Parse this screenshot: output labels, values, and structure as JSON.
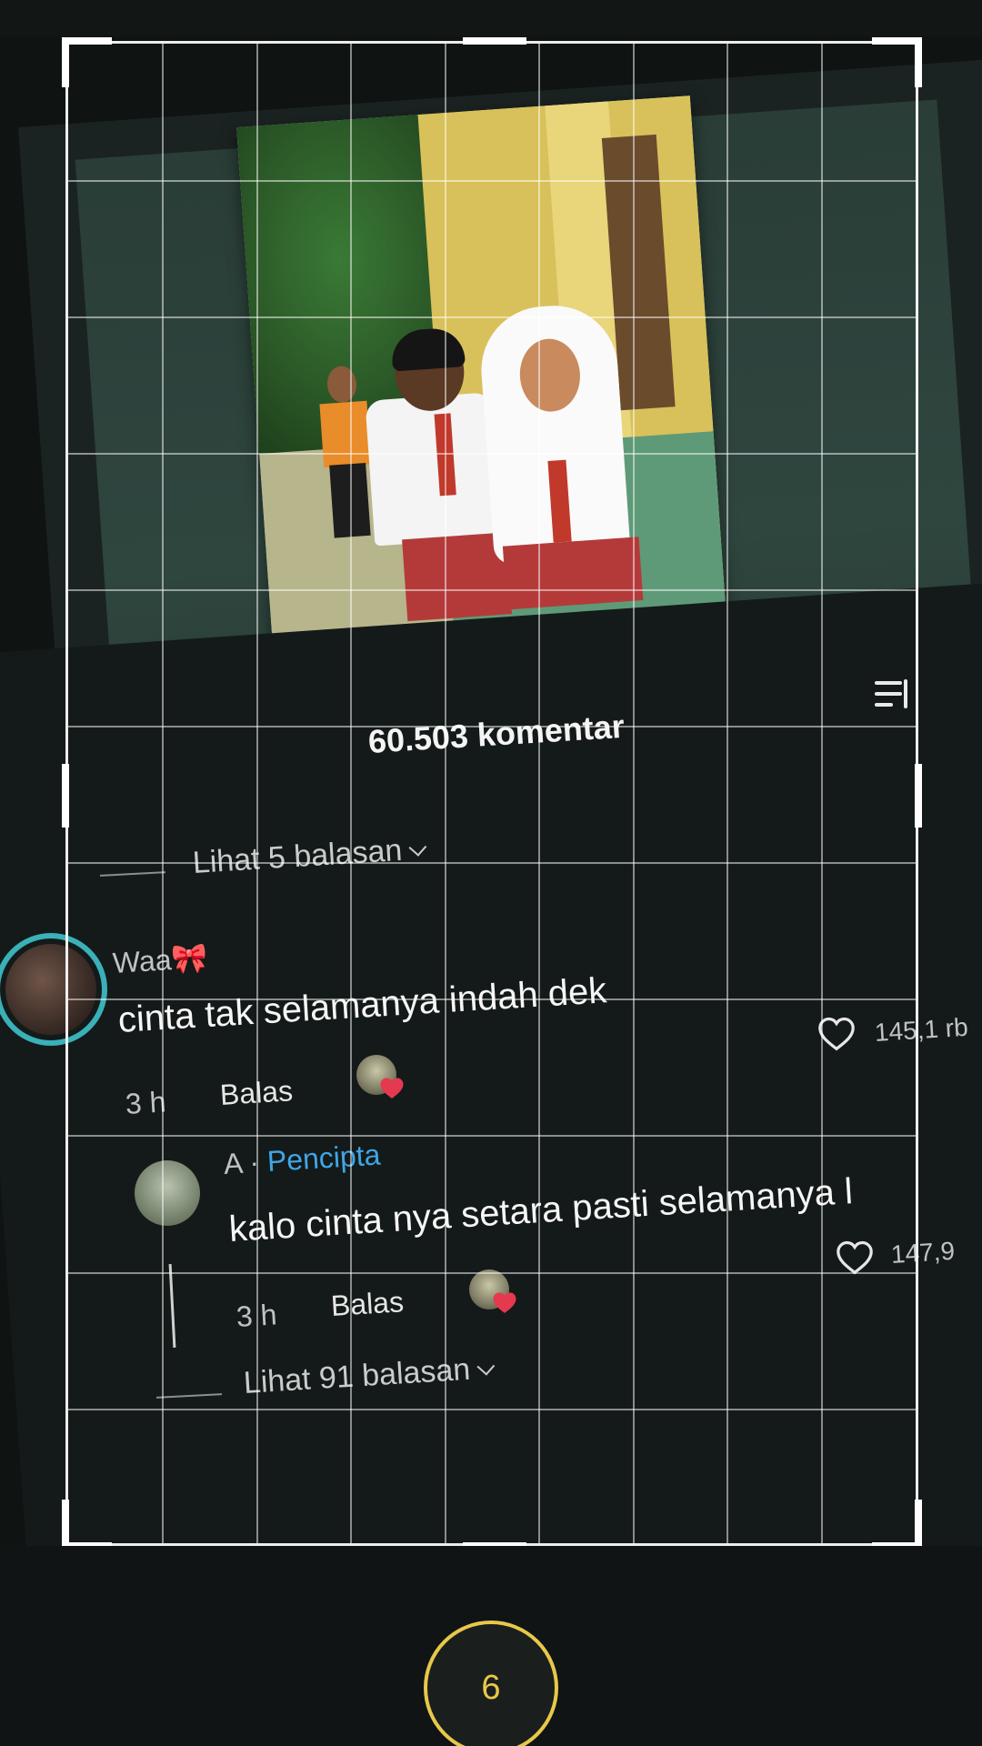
{
  "comments_panel": {
    "count_label": "60.503 komentar",
    "see_replies_top": "Lihat 5 balasan",
    "items": [
      {
        "username": "Waa",
        "username_emoji": "🎀",
        "text": "cinta tak selamanya indah dek",
        "likes": "14",
        "likes_tail": "5,1 rb",
        "time": "3 h",
        "reply_label": "Balas"
      },
      {
        "username": "A",
        "creator_label": "Pencipta",
        "text": "kalo cinta nya setara pasti selamanya l",
        "likes": "147,9",
        "time": "3 h",
        "reply_label": "Balas",
        "see_replies": "Lihat 91 balasan"
      }
    ]
  },
  "record_button": {
    "label": "6"
  },
  "colors": {
    "creator_accent": "#3fa6e6",
    "avatar_ring": "#3ab0b8",
    "record_accent": "#e8c84a",
    "heart_red": "#e53950"
  }
}
